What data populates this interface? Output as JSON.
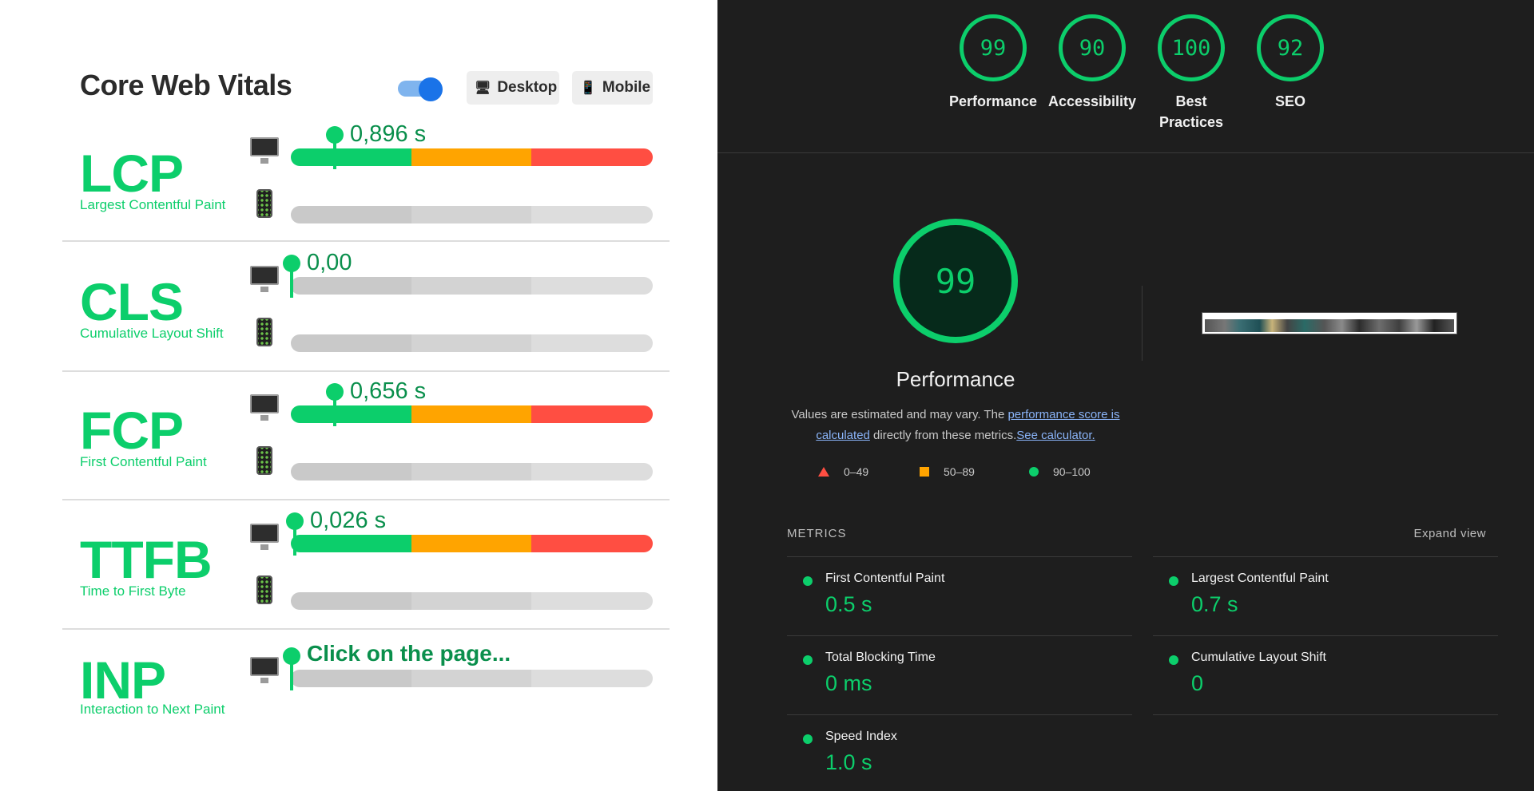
{
  "core_web_vitals": {
    "title": "Core Web Vitals",
    "toggle_on": true,
    "desktop_label": "Desktop",
    "mobile_label": "Mobile",
    "metrics": [
      {
        "abbr": "LCP",
        "name": "Largest Contentful Paint",
        "desktop_value": "0,896 s"
      },
      {
        "abbr": "CLS",
        "name": "Cumulative Layout Shift",
        "desktop_value": "0,00"
      },
      {
        "abbr": "FCP",
        "name": "First Contentful Paint",
        "desktop_value": "0,656 s"
      },
      {
        "abbr": "TTFB",
        "name": "Time to First Byte",
        "desktop_value": "0,026 s"
      },
      {
        "abbr": "INP",
        "name": "Interaction to Next Paint",
        "desktop_value": "Click on the page..."
      }
    ],
    "colors": {
      "good": "#0cce6b",
      "needs_improvement": "#ffa400",
      "poor": "#ff4e42"
    }
  },
  "lighthouse": {
    "scores": [
      {
        "value": "99",
        "label": "Performance"
      },
      {
        "value": "90",
        "label": "Accessibility"
      },
      {
        "value": "100",
        "label": "Best Practices"
      },
      {
        "value": "92",
        "label": "SEO"
      }
    ],
    "performance": {
      "score": "99",
      "title": "Performance",
      "desc_prefix": "Values are estimated and may vary. The ",
      "desc_link1": "performance score is calculated",
      "desc_mid": " directly from these metrics.",
      "desc_link2": "See calculator."
    },
    "legend": {
      "poor": "0–49",
      "average": "50–89",
      "good": "90–100"
    },
    "metrics_heading": "METRICS",
    "expand_label": "Expand view",
    "metrics": [
      {
        "label": "First Contentful Paint",
        "value": "0.5 s"
      },
      {
        "label": "Largest Contentful Paint",
        "value": "0.7 s"
      },
      {
        "label": "Total Blocking Time",
        "value": "0 ms"
      },
      {
        "label": "Cumulative Layout Shift",
        "value": "0"
      },
      {
        "label": "Speed Index",
        "value": "1.0 s"
      }
    ]
  }
}
